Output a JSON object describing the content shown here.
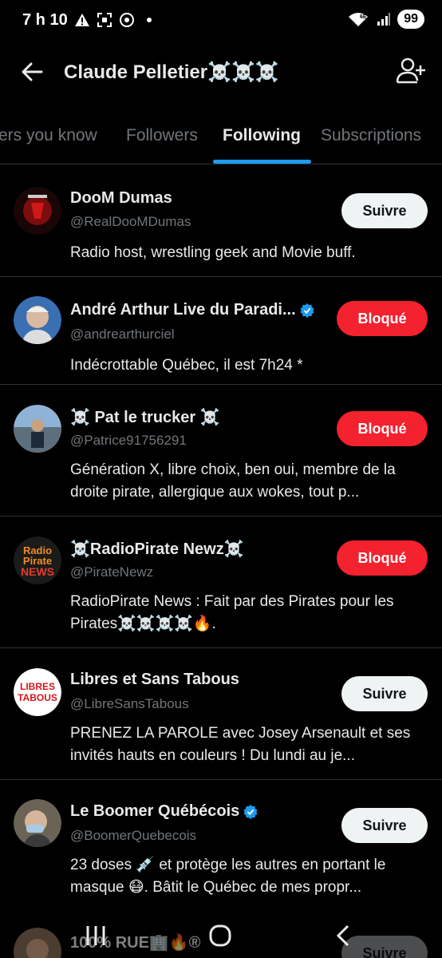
{
  "status": {
    "time": "7 h 10",
    "battery": "99",
    "network": "6E"
  },
  "header": {
    "title": "Claude Pelletier☠️☠️☠️"
  },
  "tabs": [
    {
      "label": "ers you know",
      "active": false
    },
    {
      "label": "Followers",
      "active": false
    },
    {
      "label": "Following",
      "active": true
    },
    {
      "label": "Subscriptions",
      "active": false
    }
  ],
  "accounts": [
    {
      "name": "DooM Dumas",
      "handle": "@RealDooMDumas",
      "bio": "Radio host, wrestling geek and Movie buff.",
      "button": "Suivre",
      "verified": false
    },
    {
      "name": "André Arthur Live du Paradi...",
      "handle": "@andrearthurciel",
      "bio": "Indécrottable Québec, il est 7h24 *",
      "button": "Bloqué",
      "verified": true
    },
    {
      "name": "☠️ Pat le trucker ☠️",
      "handle": "@Patrice91756291",
      "bio": "Génération X, libre choix, ben oui, membre de la droite pirate, allergique aux wokes, tout p...",
      "button": "Bloqué",
      "verified": false
    },
    {
      "name": "☠️RadioPirate Newz☠️",
      "handle": "@PirateNewz",
      "bio": "RadioPirate News : Fait par des Pirates pour les Pirates☠️☠️☠️☠️🔥.",
      "button": "Bloqué",
      "verified": false
    },
    {
      "name": "Libres et Sans Tabous",
      "handle": "@LibreSansTabous",
      "bio": "PRENEZ LA PAROLE avec Josey Arsenault et ses invités hauts en couleurs ! Du lundi au je...",
      "button": "Suivre",
      "verified": false
    },
    {
      "name": "Le Boomer Québécois",
      "handle": "@BoomerQuebecois",
      "bio": "23 doses 💉 et protège les autres en portant le masque 😷. Bâtit le Québec de mes propr...",
      "button": "Suivre",
      "verified": true
    }
  ],
  "partial_row": {
    "name": "100% RUE🏢🔥®",
    "button": "Suivre"
  },
  "avatar_texts": {
    "radio_pirate_top": "Radio",
    "radio_pirate_mid": "Pirate",
    "radio_pirate_bottom": "NEWS",
    "libres_top": "LIBRES",
    "libres_bottom": "TABOUS"
  },
  "colors": {
    "accent": "#1d9bf0",
    "blocked": "#f4212e",
    "follow_bg": "#eff3f4"
  }
}
